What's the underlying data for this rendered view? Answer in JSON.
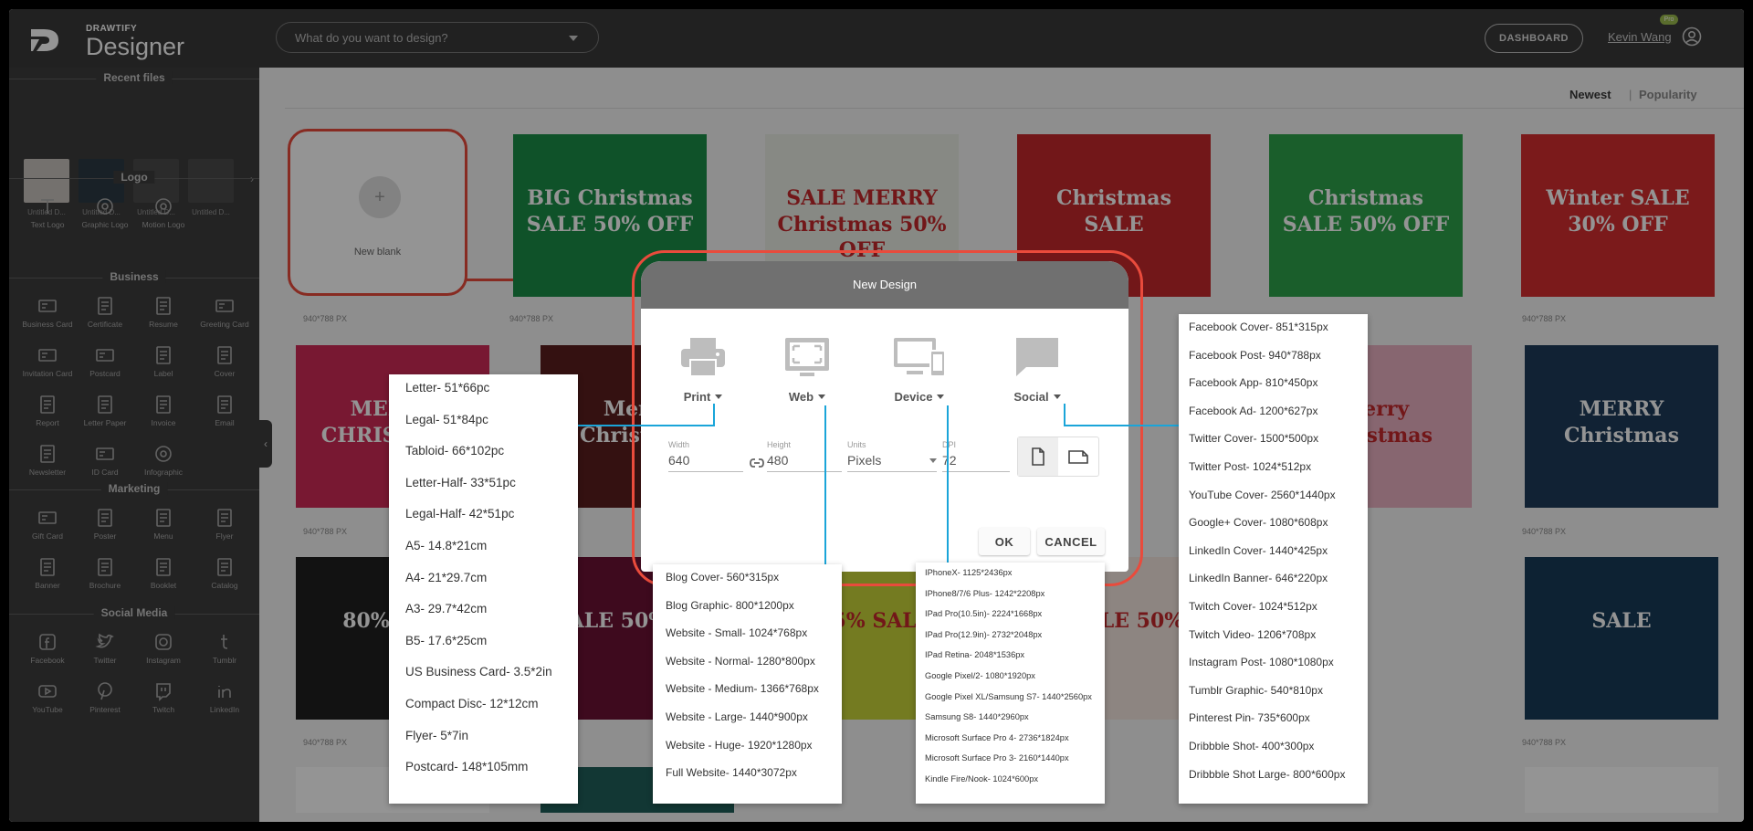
{
  "header": {
    "logo_small": "DRAWTIFY",
    "logo_big": "Designer",
    "search_placeholder": "What do you want to design?",
    "dashboard_label": "DASHBOARD",
    "user_name": "Kevin Wang",
    "pro_badge": "Pro"
  },
  "sidebar": {
    "recent_title": "Recent files",
    "recent_files": [
      {
        "caption": "Untitled D...",
        "color": "#c9c3bd"
      },
      {
        "caption": "Untitled D...",
        "color": "#2b3a44"
      },
      {
        "caption": "Untitled D...",
        "color": "#4a4a4a"
      },
      {
        "caption": "Untitled D...",
        "color": "#4a4a4a"
      }
    ],
    "sections": [
      {
        "title": "Logo",
        "items": [
          "Text Logo",
          "Graphic Logo",
          "Motion Logo"
        ]
      },
      {
        "title": "Business",
        "items": [
          "Business Card",
          "Certificate",
          "Resume",
          "Greeting Card",
          "Invitation Card",
          "Postcard",
          "Label",
          "Cover",
          "Report",
          "Letter Paper",
          "Invoice",
          "Email",
          "Newsletter",
          "ID Card",
          "Infographic"
        ]
      },
      {
        "title": "Marketing",
        "items": [
          "Gift Card",
          "Poster",
          "Menu",
          "Flyer",
          "Banner",
          "Brochure",
          "Booklet",
          "Catalog"
        ]
      },
      {
        "title": "Social Media",
        "items": [
          "Facebook",
          "Twitter",
          "Instagram",
          "Tumblr",
          "YouTube",
          "Pinterest",
          "Twitch",
          "LinkedIn"
        ]
      }
    ]
  },
  "main": {
    "sort_newest": "Newest",
    "sort_separator": "|",
    "sort_popularity": "Popularity",
    "new_blank_label": "New blank",
    "size_captions": [
      "940*788 PX",
      "940*788 PX",
      "940*788 PX",
      "940*788 PX",
      "940*788 PX",
      "940*788 PX",
      "940*788 PX"
    ]
  },
  "templates": [
    {
      "title": "BIG Christmas SALE 50% OFF",
      "bg": "#1b8d48"
    },
    {
      "title": "SALE MERRY Christmas 50% OFF",
      "bg": "#e8ede3"
    },
    {
      "title": "Christmas SALE",
      "bg": "#c4282b"
    },
    {
      "title": "Christmas SALE 50% OFF",
      "bg": "#2ea24b"
    },
    {
      "title": "Winter SALE 30% OFF",
      "bg": "#d42e2f"
    },
    {
      "title": "MERRY CHRISTMAS",
      "bg": "#cf2a57"
    },
    {
      "title": "Merry Christmas",
      "bg": "#5a1e1e"
    },
    {
      "title": "Merry Christmas",
      "bg": "#e9b0c2"
    },
    {
      "title": "MERRY Christmas",
      "bg": "#1e3c5a"
    },
    {
      "title": "Merry Christmas",
      "bg": "#1d2a4a"
    },
    {
      "title": "80% OFF",
      "bg": "#1f1f1f"
    },
    {
      "title": "SALE 50% OFF",
      "bg": "#6b1235"
    },
    {
      "title": "5% SALE",
      "bg": "#c9d43a"
    },
    {
      "title": "SALE 50%",
      "bg": "#f3e6df"
    },
    {
      "title": "SALE",
      "bg": "#173b58"
    }
  ],
  "modal": {
    "title": "New Design",
    "categories": [
      "Print",
      "Web",
      "Device",
      "Social"
    ],
    "width_label": "Width",
    "width_value": "640",
    "height_label": "Height",
    "height_value": "480",
    "units_label": "Units",
    "units_value": "Pixels",
    "dpi_label": "DPI",
    "dpi_value": "72",
    "ok_label": "OK",
    "cancel_label": "CANCEL"
  },
  "print_options": [
    "Letter- 51*66pc",
    "Legal- 51*84pc",
    "Tabloid- 66*102pc",
    "Letter-Half- 33*51pc",
    "Legal-Half- 42*51pc",
    "A5- 14.8*21cm",
    "A4- 21*29.7cm",
    "A3- 29.7*42cm",
    "B5- 17.6*25cm",
    "US Business Card- 3.5*2in",
    "Compact Disc- 12*12cm",
    "Flyer- 5*7in",
    "Postcard- 148*105mm"
  ],
  "web_options": [
    "Blog Cover- 560*315px",
    "Blog Graphic- 800*1200px",
    "Website - Small- 1024*768px",
    "Website - Normal- 1280*800px",
    "Website - Medium- 1366*768px",
    "Website - Large- 1440*900px",
    "Website - Huge- 1920*1280px",
    "Full Website- 1440*3072px"
  ],
  "device_options": [
    "IPhoneX- 1125*2436px",
    "IPhone8/7/6 Plus- 1242*2208px",
    "IPad Pro(10.5in)- 2224*1668px",
    "IPad Pro(12.9in)- 2732*2048px",
    "IPad Retina- 2048*1536px",
    "Google Pixel/2- 1080*1920px",
    "Google Pixel XL/Samsung S7- 1440*2560px",
    "Samsung S8- 1440*2960px",
    "Microsoft Surface Pro 4- 2736*1824px",
    "Microsoft Surface Pro 3- 2160*1440px",
    "Kindle Fire/Nook- 1024*600px"
  ],
  "social_options": [
    "Facebook Cover- 851*315px",
    "Facebook Post- 940*788px",
    "Facebook App- 810*450px",
    "Facebook Ad- 1200*627px",
    "Twitter Cover- 1500*500px",
    "Twitter Post- 1024*512px",
    "YouTube Cover- 2560*1440px",
    "Google+ Cover- 1080*608px",
    "LinkedIn Cover- 1440*425px",
    "LinkedIn Banner- 646*220px",
    "Twitch Cover- 1024*512px",
    "Twitch Video- 1206*708px",
    "Instagram Post- 1080*1080px",
    "Tumblr Graphic- 540*810px",
    "Pinterest Pin- 735*600px",
    "Dribbble Shot- 400*300px",
    "Dribbble Shot Large- 800*600px"
  ],
  "colors": {
    "accent_red": "#e94b3c",
    "connector_blue": "#1aa5d9",
    "topbar": "#3a3a3a",
    "sidebar": "#3d3d3d"
  }
}
